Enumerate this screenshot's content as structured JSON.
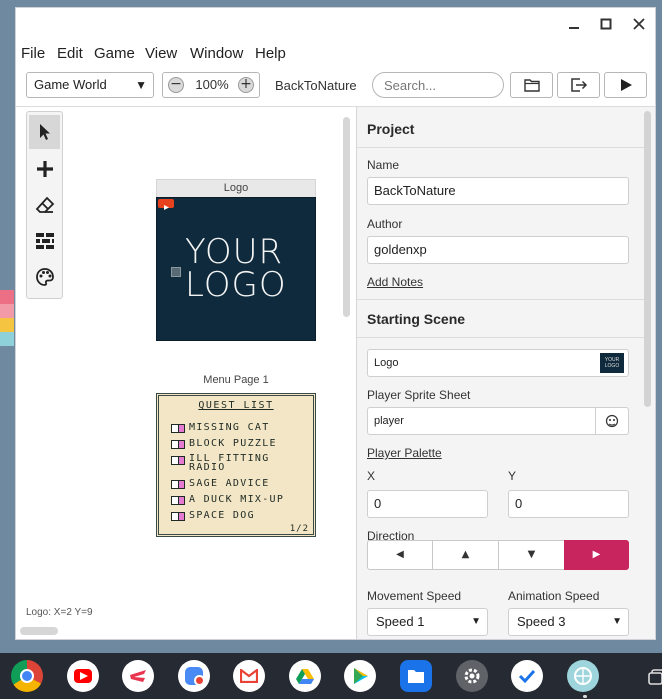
{
  "window": {
    "minimize_icon": "minimize-icon",
    "maximize_icon": "maximize-icon",
    "close_icon": "close-icon"
  },
  "menubar": {
    "items": [
      "File",
      "Edit",
      "Game",
      "View",
      "Window",
      "Help"
    ]
  },
  "toolbar": {
    "view_select": "Game World",
    "zoom_value": "100%",
    "project_name": "BackToNature",
    "search_placeholder": "Search...",
    "buttons": [
      "folder-icon",
      "export-icon",
      "play-icon"
    ]
  },
  "world": {
    "tools": [
      "select-arrow-icon",
      "add-icon",
      "eraser-icon",
      "bricks-icon",
      "palette-icon"
    ],
    "scenes": [
      {
        "label": "Logo",
        "logo_lines": [
          "YOUR",
          "LOGO"
        ]
      },
      {
        "label": "Menu Page 1",
        "menu_title": "QUEST LIST",
        "menu_items": [
          "MISSING CAT",
          "BLOCK PUZZLE",
          "ILL FITTING RADIO",
          "SAGE ADVICE",
          "A DUCK MIX-UP",
          "SPACE DOG"
        ],
        "page": "1/2"
      }
    ],
    "status": "Logo: X=2 Y=9"
  },
  "panel": {
    "project_title": "Project",
    "name_label": "Name",
    "name_value": "BackToNature",
    "author_label": "Author",
    "author_value": "goldenxp",
    "add_notes": "Add Notes",
    "starting_scene_title": "Starting Scene",
    "scene_value": "Logo",
    "scene_thumb_text": "YOUR LOGO",
    "sprite_label": "Player Sprite Sheet",
    "sprite_value": "player",
    "palette_link": "Player Palette",
    "x_label": "X",
    "x_value": "0",
    "y_label": "Y",
    "y_value": "0",
    "direction_label": "Direction",
    "directions": [
      "◀",
      "▲",
      "▼",
      "▶"
    ],
    "selected_direction": 3,
    "movement_label": "Movement Speed",
    "movement_value": "Speed 1",
    "animation_label": "Animation Speed",
    "animation_value": "Speed 3"
  },
  "colors": {
    "accent": "#c8245e",
    "logo_bg": "#0e2a3c",
    "menu_bg": "#f3e6c6",
    "menu_check": "#e37bd1",
    "shelf": "#262a33"
  },
  "shelf": {
    "apps": [
      "chrome-icon",
      "youtube-icon",
      "stadia-icon",
      "camera-icon",
      "gmail-icon",
      "drive-icon",
      "play-store-icon",
      "files-icon",
      "settings-icon",
      "tasks-icon",
      "gb-studio-icon",
      "overview-icon"
    ]
  }
}
